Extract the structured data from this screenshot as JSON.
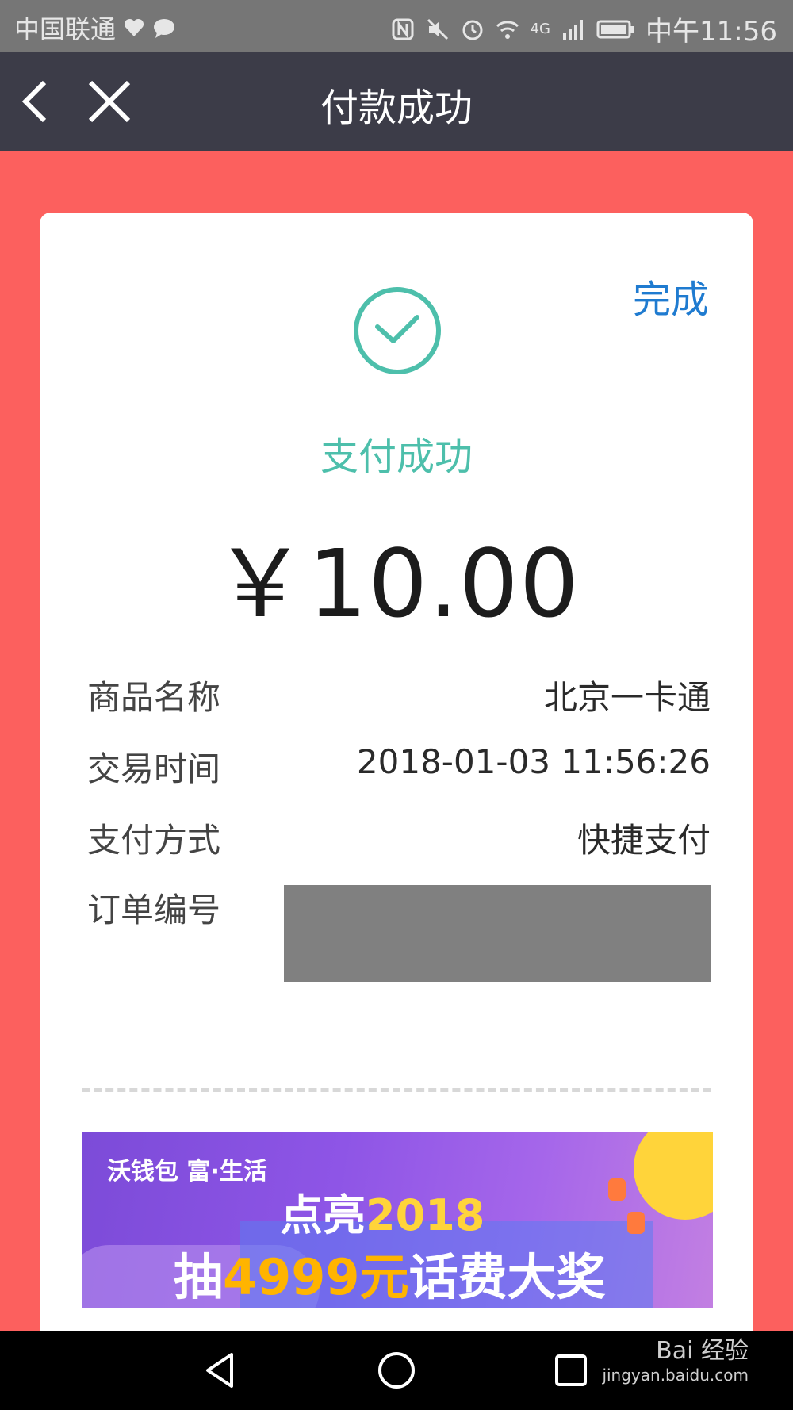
{
  "status_bar": {
    "carrier": "中国联通",
    "network": "4G",
    "time": "中午11:56"
  },
  "nav": {
    "title": "付款成功"
  },
  "card": {
    "done_label": "完成",
    "status_text": "支付成功",
    "amount": "￥10.00",
    "rows": [
      {
        "label": "商品名称",
        "value": "北京一卡通"
      },
      {
        "label": "交易时间",
        "value": "2018-01-03 11:56:26"
      },
      {
        "label": "支付方式",
        "value": "快捷支付"
      },
      {
        "label": "订单编号",
        "value": ""
      }
    ]
  },
  "banner": {
    "brand": "沃钱包 富·生活",
    "line1_prefix": "点亮",
    "line1_year": "2018",
    "line2_prefix": "抽",
    "line2_amount": "4999元",
    "line2_suffix": "话费大奖"
  },
  "watermark": {
    "brand": "Bai 经验",
    "url": "jingyan.baidu.com"
  },
  "colors": {
    "accent_green": "#4dbfab",
    "link_blue": "#1f7bd0",
    "background_red": "#fc605e",
    "nav_dark": "#3c3c48"
  }
}
